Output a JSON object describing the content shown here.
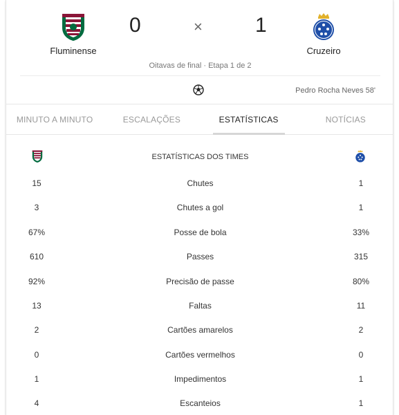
{
  "match": {
    "home": {
      "name": "Fluminense",
      "score": "0"
    },
    "away": {
      "name": "Cruzeiro",
      "score": "1"
    },
    "separator": "×",
    "round": "Oitavas de final · Etapa 1 de 2",
    "goal": {
      "icon": "soccer-ball-icon",
      "scorer": "Pedro Rocha Neves 58'"
    }
  },
  "tabs": [
    {
      "label": "MINUTO A MINUTO",
      "active": false
    },
    {
      "label": "ESCALAÇÕES",
      "active": false
    },
    {
      "label": "ESTATÍSTICAS",
      "active": true
    },
    {
      "label": "NOTÍCIAS",
      "active": false
    }
  ],
  "stats": {
    "title": "ESTATÍSTICAS DOS TIMES",
    "rows": [
      {
        "home": "15",
        "label": "Chutes",
        "away": "1"
      },
      {
        "home": "3",
        "label": "Chutes a gol",
        "away": "1"
      },
      {
        "home": "67%",
        "label": "Posse de bola",
        "away": "33%"
      },
      {
        "home": "610",
        "label": "Passes",
        "away": "315"
      },
      {
        "home": "92%",
        "label": "Precisão de passe",
        "away": "80%"
      },
      {
        "home": "13",
        "label": "Faltas",
        "away": "11"
      },
      {
        "home": "2",
        "label": "Cartões amarelos",
        "away": "2"
      },
      {
        "home": "0",
        "label": "Cartões vermelhos",
        "away": "0"
      },
      {
        "home": "1",
        "label": "Impedimentos",
        "away": "1"
      },
      {
        "home": "4",
        "label": "Escanteios",
        "away": "1"
      }
    ]
  },
  "colors": {
    "fluminense_maroon": "#8a1538",
    "fluminense_green": "#006b3f",
    "cruzeiro_blue": "#1f4fa8",
    "crown_gold": "#e1b12c",
    "active_tab_underline": "#d6d6d6"
  }
}
